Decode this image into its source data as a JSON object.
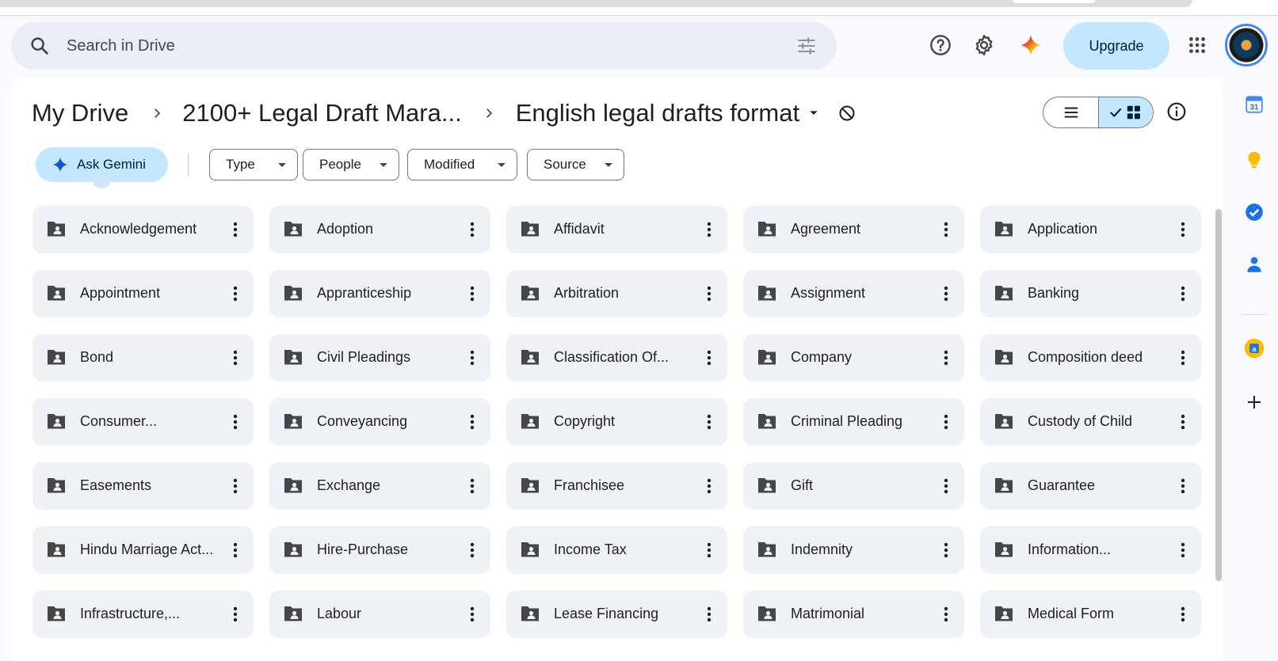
{
  "search": {
    "placeholder": "Search in Drive"
  },
  "header": {
    "upgrade_label": "Upgrade"
  },
  "breadcrumb": {
    "root": "My Drive",
    "parent": "2100+ Legal Draft Mara...",
    "current": "English legal drafts format"
  },
  "toolbar": {
    "ask_gemini": "Ask Gemini"
  },
  "filters": [
    {
      "label": "Type"
    },
    {
      "label": "People"
    },
    {
      "label": "Modified"
    },
    {
      "label": "Source"
    }
  ],
  "folders": [
    "Acknowledgement",
    "Adoption",
    "Affidavit",
    "Agreement",
    "Application",
    "Appointment",
    "Appranticeship",
    "Arbitration",
    "Assignment",
    "Banking",
    "Bond",
    "Civil Pleadings",
    "Classification Of...",
    "Company",
    "Composition deed",
    "Consumer...",
    "Conveyancing",
    "Copyright",
    "Criminal Pleading",
    "Custody of Child",
    "Easements",
    "Exchange",
    "Franchisee",
    "Gift",
    "Guarantee",
    "Hindu Marriage Act...",
    "Hire-Purchase",
    "Income Tax",
    "Indemnity",
    "Information...",
    "Infrastructure,...",
    "Labour",
    "Lease Financing",
    "Matrimonial",
    "Medical Form"
  ],
  "side_panel": {
    "calendar_day": "31"
  },
  "colors": {
    "accent": "#c2e7ff",
    "chip_bg": "#eef1f6",
    "page_bg": "#f8fafd"
  }
}
